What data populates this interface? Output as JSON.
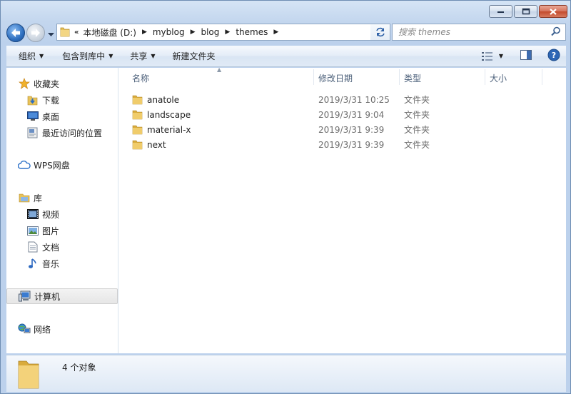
{
  "window": {
    "caption_buttons": [
      "minimize",
      "maximize",
      "close"
    ]
  },
  "address": {
    "overflow": "«",
    "crumbs": [
      "本地磁盘 (D:)",
      "myblog",
      "blog",
      "themes"
    ]
  },
  "search": {
    "placeholder": "搜索 themes"
  },
  "toolbar": {
    "organize": "组织",
    "include_in_library": "包含到库中",
    "share": "共享",
    "new_folder": "新建文件夹"
  },
  "nav": {
    "favorites": "收藏夹",
    "downloads": "下载",
    "desktop": "桌面",
    "recent": "最近访问的位置",
    "wps": "WPS网盘",
    "libraries": "库",
    "videos": "视频",
    "pictures": "图片",
    "documents": "文档",
    "music": "音乐",
    "computer": "计算机",
    "network": "网络"
  },
  "columns": {
    "name": "名称",
    "date": "修改日期",
    "type": "类型",
    "size": "大小"
  },
  "files": [
    {
      "name": "anatole",
      "date": "2019/3/31 10:25",
      "type": "文件夹"
    },
    {
      "name": "landscape",
      "date": "2019/3/31 9:04",
      "type": "文件夹"
    },
    {
      "name": "material-x",
      "date": "2019/3/31 9:39",
      "type": "文件夹"
    },
    {
      "name": "next",
      "date": "2019/3/31 9:39",
      "type": "文件夹"
    }
  ],
  "status": {
    "count": "4 个对象"
  },
  "colors": {
    "accent": "#2e6fbf",
    "folder": "#e8c35a",
    "close": "#c34a2c"
  }
}
